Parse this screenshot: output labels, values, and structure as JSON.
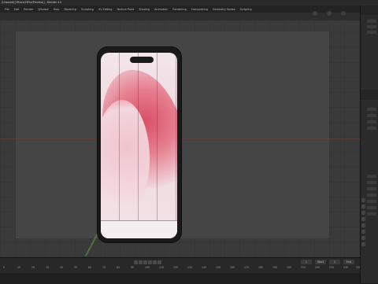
{
  "window": {
    "title": "[Unsaved] [iPhone15Pro(Preview)] - Blender 4.0"
  },
  "menubar": {
    "items": [
      "File",
      "Edit",
      "Render",
      "Window",
      "Help",
      "Modeling",
      "Sculpting",
      "UV Editing",
      "Texture Paint",
      "Shading",
      "Animation",
      "Rendering",
      "Compositing",
      "Geometry Nodes",
      "Scripting"
    ]
  },
  "timeline": {
    "ruler_ticks": [
      "0",
      "10",
      "20",
      "30",
      "40",
      "50",
      "60",
      "70",
      "80",
      "90",
      "100",
      "110",
      "120",
      "130",
      "140",
      "150",
      "160",
      "170",
      "180",
      "190",
      "200",
      "210",
      "220",
      "230",
      "240",
      "250"
    ],
    "frame_labels": [
      "1",
      "Start",
      "1",
      "End"
    ]
  },
  "colors": {
    "accent": "#d94f65",
    "viewport": "#3a3a3a"
  }
}
